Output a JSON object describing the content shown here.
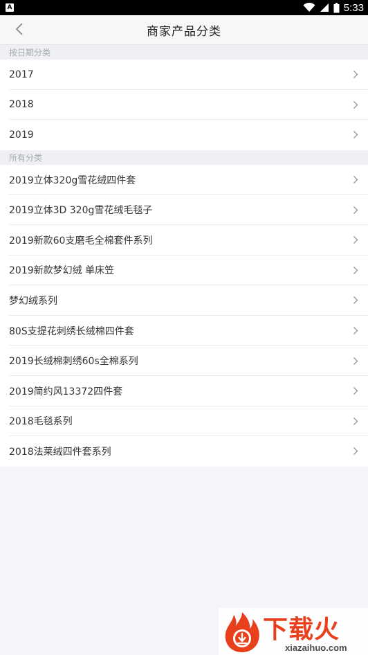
{
  "status_bar": {
    "notification_icon": "A",
    "time": "5:33",
    "icons": [
      "wifi-icon",
      "signal-icon",
      "battery-icon"
    ]
  },
  "header": {
    "title": "商家产品分类",
    "back_icon": "chevron-left-icon"
  },
  "sections": [
    {
      "title": "按日期分类",
      "items": [
        "2017",
        "2018",
        "2019"
      ]
    },
    {
      "title": "所有分类",
      "items": [
        "2019立体320g雪花绒四件套",
        "2019立体3D 320g雪花绒毛毯子",
        "2019新款60支磨毛全棉套件系列",
        "2019新款梦幻绒 单床笠",
        "梦幻绒系列",
        "80S支提花刺绣长绒棉四件套",
        "2019长绒棉刺绣60s全棉系列",
        "2019简约风13372四件套",
        "2018毛毯系列",
        "2018法莱绒四件套系列"
      ]
    }
  ],
  "watermark": {
    "text": "下载火",
    "domain": "xiazaihuo.com"
  },
  "colors": {
    "background": "#f3f5f8",
    "text": "#333333",
    "section_title": "#a6a9ae",
    "chevron": "#9a9a9a",
    "watermark_accent": "#e8401c"
  }
}
